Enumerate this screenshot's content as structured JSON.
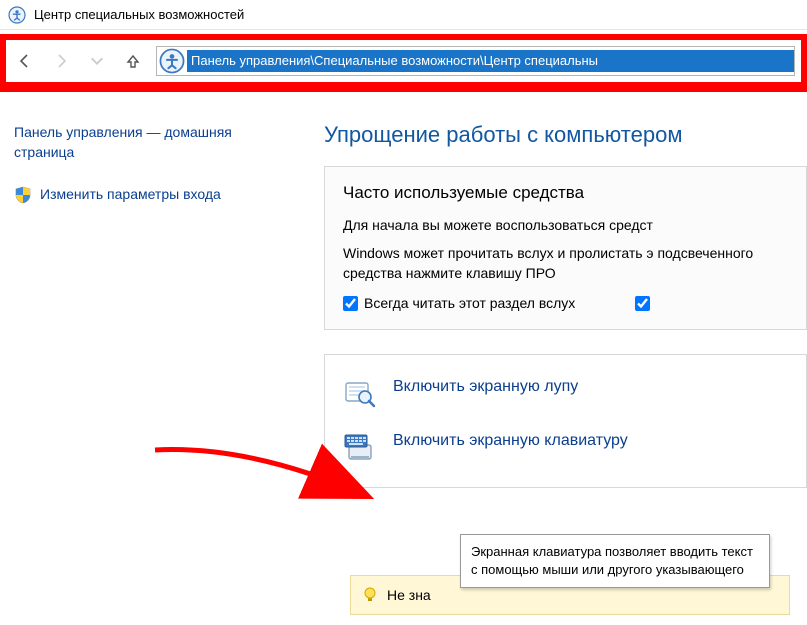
{
  "window": {
    "title": "Центр специальных возможностей"
  },
  "addressbar": {
    "path": "Панель управления\\Специальные возможности\\Центр специальны"
  },
  "sidebar": {
    "home": "Панель управления — домашняя страница",
    "signin": "Изменить параметры входа"
  },
  "main": {
    "title": "Упрощение работы с компьютером",
    "panel": {
      "heading": "Часто используемые средства",
      "p1": "Для начала вы можете воспользоваться средст",
      "p2": "Windows может прочитать вслух и пролистать э подсвеченного средства нажмите клавишу ПРО",
      "chk1": "Всегда читать этот раздел вслух",
      "chk2": ""
    },
    "tools": {
      "magnifier": "Включить экранную лупу",
      "osk": "Включить экранную клавиатуру"
    },
    "tooltip": "Экранная клавиатура позволяет вводить текст с помощью мыши или другого указывающего",
    "banner": "Не зна"
  }
}
